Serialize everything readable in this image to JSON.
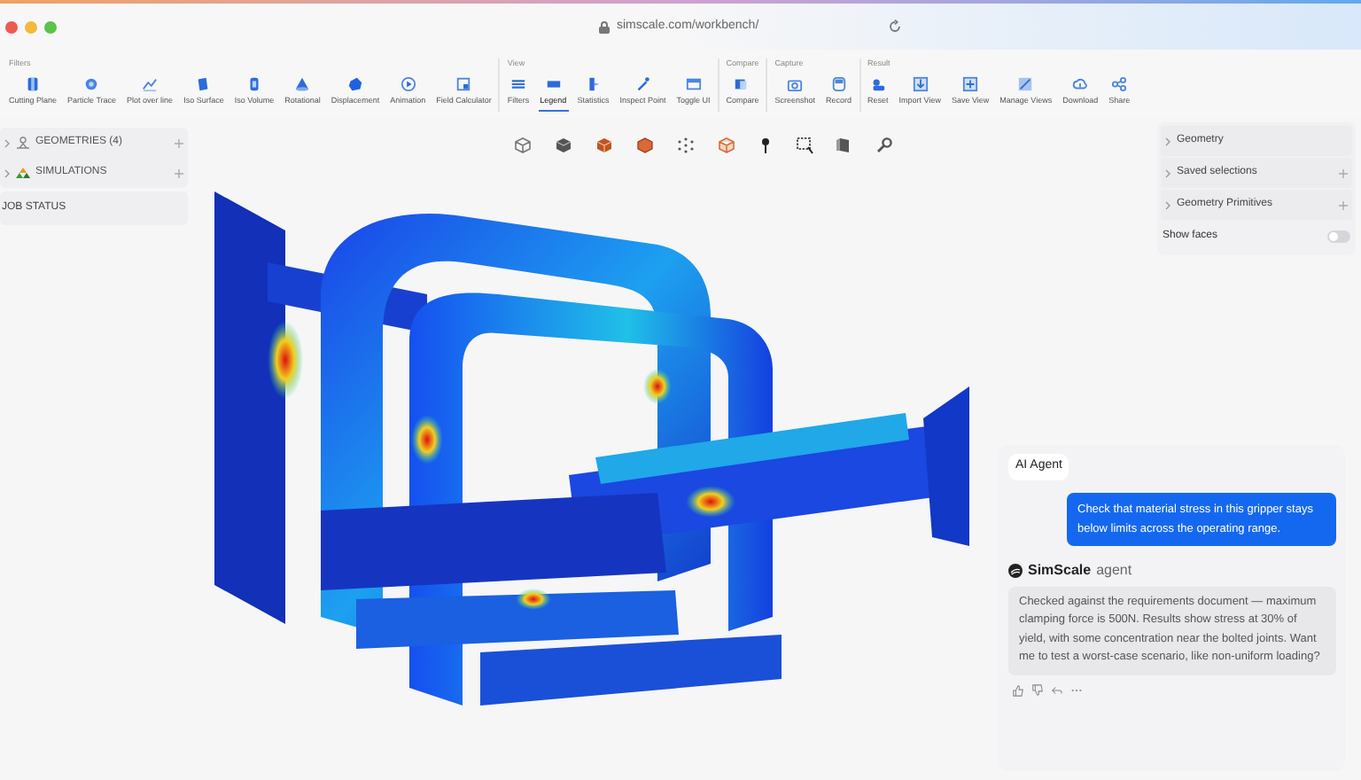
{
  "window": {
    "url": "simscale.com/workbench/"
  },
  "toolbar": {
    "groups": [
      {
        "label": "Filters",
        "items": [
          {
            "label": "Cutting Plane",
            "selected": false
          },
          {
            "label": "Particle Trace",
            "selected": false
          },
          {
            "label": "Plot over line",
            "selected": false
          },
          {
            "label": "Iso Surface",
            "selected": false
          },
          {
            "label": "Iso Volume",
            "selected": false
          },
          {
            "label": "Rotational",
            "selected": false
          },
          {
            "label": "Displacement",
            "selected": false
          },
          {
            "label": "Animation",
            "selected": false
          },
          {
            "label": "Field Calculator",
            "selected": false
          }
        ]
      },
      {
        "label": "View",
        "items": [
          {
            "label": "Filters",
            "selected": false
          },
          {
            "label": "Legend",
            "selected": true
          },
          {
            "label": "Statistics",
            "selected": false
          },
          {
            "label": "Inspect Point",
            "selected": false
          },
          {
            "label": "Toggle UI",
            "selected": false
          }
        ]
      },
      {
        "label": "Compare",
        "items": [
          {
            "label": "Compare",
            "selected": false
          }
        ]
      },
      {
        "label": "Capture",
        "items": [
          {
            "label": "Screenshot",
            "selected": false
          },
          {
            "label": "Record",
            "selected": false
          }
        ]
      },
      {
        "label": "Result",
        "items": [
          {
            "label": "Reset",
            "selected": false
          },
          {
            "label": "Import View",
            "selected": false
          },
          {
            "label": "Save View",
            "selected": false
          },
          {
            "label": "Manage Views",
            "selected": false
          },
          {
            "label": "Download",
            "selected": false
          },
          {
            "label": "Share",
            "selected": false
          }
        ]
      }
    ]
  },
  "tree": {
    "items": [
      {
        "label": "GEOMETRIES (4)",
        "expanded": false
      },
      {
        "label": "SIMULATIONS",
        "expanded": false
      }
    ],
    "section": "JOB STATUS"
  },
  "scene_panel": {
    "items": [
      {
        "label": "Geometry",
        "addable": false
      },
      {
        "label": "Saved selections",
        "addable": true
      },
      {
        "label": "Geometry Primitives",
        "addable": true
      }
    ],
    "toggle": {
      "label": "Show faces",
      "on": false
    }
  },
  "chat": {
    "chip": "AI Agent",
    "messages": [
      {
        "kind": "user",
        "text": "Check that material stress in this gripper stays below limits across the operating range."
      },
      {
        "kind": "agent",
        "sender": "SimScale",
        "sender_suffix": "agent",
        "text": "Checked against the requirements document — maximum clamping force is 500N. Results show stress at 30% of yield, with some concentration near the bolted joints. Want me to test a worst-case scenario, like non-uniform loading?"
      }
    ]
  }
}
